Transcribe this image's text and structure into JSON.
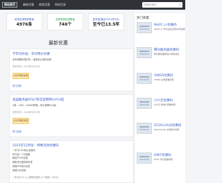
{
  "header": {
    "logo": "网站首页",
    "nav": [
      "最新优惠",
      "商家优惠",
      "网站目录"
    ],
    "search_placeholder": "搜索关键词"
  },
  "stats": [
    {
      "label": "收录优惠商家数量",
      "value": "4976条"
    },
    {
      "label": "全部收录优惠数量",
      "value": "746个"
    },
    {
      "label": "距年底(截至2024年9月)",
      "value": "至今已13.5年"
    }
  ],
  "section_title": "最新优惠",
  "cards": [
    {
      "title": "学年付补贴：年付特价优惠",
      "desc": "全系套餐优惠打折，续费全价保持优惠",
      "date": "发布时间：2024年9月23日",
      "button": "点击获取优惠",
      "tag": "热门优惠"
    },
    {
      "title": "美国服务器AT&T新店促销特价¥14起",
      "desc": "2核，2GB，1000M带宽，特价套餐¥14起",
      "date": "发布时间：2024年9月23日",
      "button": "点击获取优惠",
      "tag": "热门优惠"
    },
    {
      "title": "2025年12月份：特惠活动优惠码",
      "lines": [
        "一年付15%特价优惠码",
        "年付送一个月套餐",
        "新用户VPS优惠",
        "新账号注册首单优惠",
        "香港VPS特价优惠",
        "香港CN2特惠"
      ],
      "footer": "一年付价15 以上限购优惠码 (2个截至一2025)"
    }
  ],
  "sidebar": {
    "title": "热门商家",
    "items": [
      {
        "name": "WePC.cc优惠码",
        "desc": "WePC.cc 年付主机全场85折优惠"
      },
      {
        "name": "腾讯服务器优惠码",
        "desc": "腾讯服务器新用户特惠活动"
      },
      {
        "name": "VMISS优惠码",
        "desc": "VMISS 全场套餐优惠"
      },
      {
        "name": "六六云优惠码",
        "desc": "六六云 新用户首单特惠"
      },
      {
        "name": "ZGOCLOUD优惠码",
        "desc": "ZGOCLOUD 全场特价优惠"
      },
      {
        "name": "DMIT优惠码",
        "desc": "DMIT 年付套餐特惠"
      }
    ]
  }
}
